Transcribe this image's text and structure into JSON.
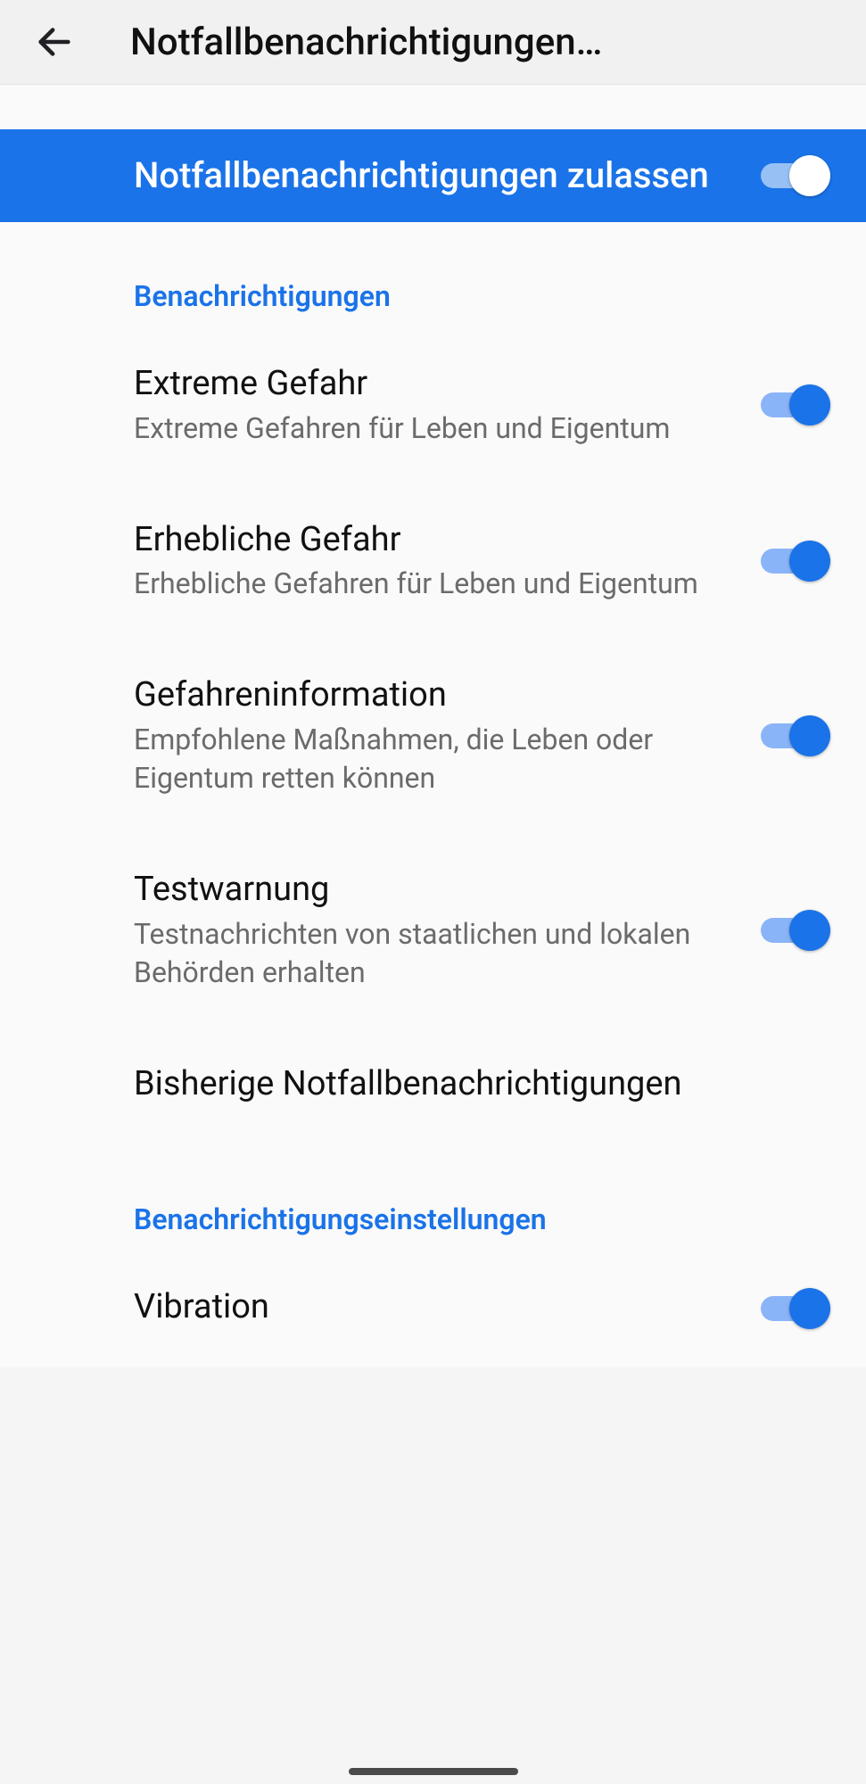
{
  "header": {
    "title": "Notfallbenachrichtigungen…"
  },
  "hero": {
    "title": "Notfallbenachrichtigungen zulassen",
    "enabled": true
  },
  "sections": {
    "notifications_header": "Benachrichtigungen",
    "settings_header": "Benachrichtigungseinstellungen"
  },
  "items": {
    "extreme": {
      "title": "Extreme Gefahr",
      "sub": "Extreme Gefahren für Leben und Eigentum",
      "enabled": true
    },
    "severe": {
      "title": "Erhebliche Gefahr",
      "sub": "Erhebliche Gefahren für Leben und Eigentum",
      "enabled": true
    },
    "info": {
      "title": "Gefahreninformation",
      "sub": "Empfohlene Maßnahmen, die Leben oder Eigentum retten können",
      "enabled": true
    },
    "test": {
      "title": "Testwarnung",
      "sub": "Testnachrichten von staatlichen und lokalen Behörden erhalten",
      "enabled": true
    },
    "history": {
      "title": "Bisherige Notfallbenachrichtigungen"
    },
    "vibration": {
      "title": "Vibration",
      "enabled": true
    }
  }
}
